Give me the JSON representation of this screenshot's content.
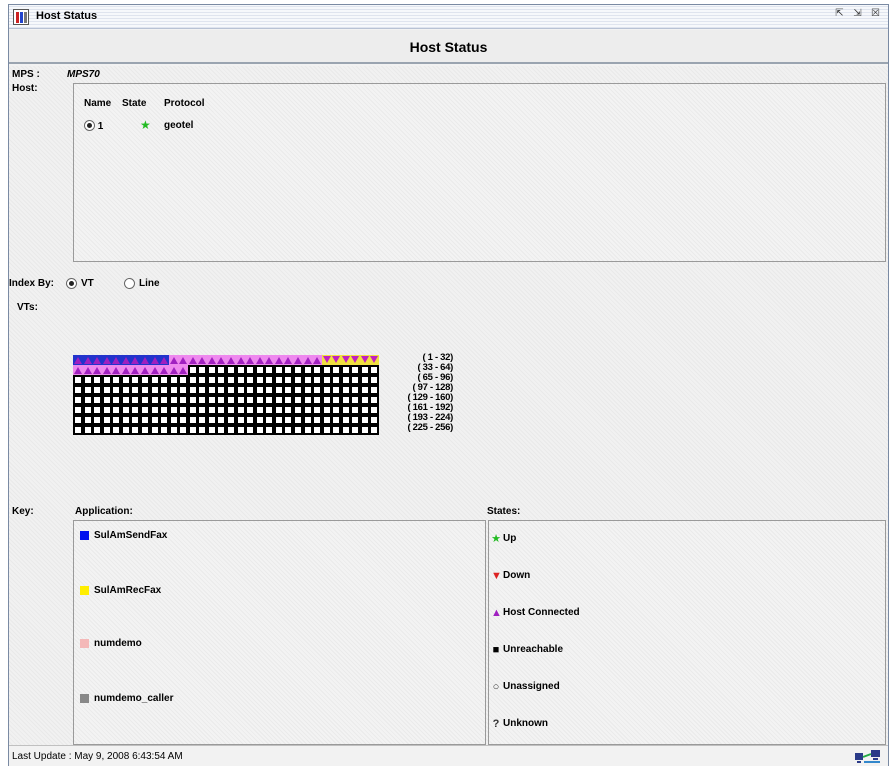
{
  "window": {
    "title": "Host Status",
    "controls": {
      "restore": "⇱",
      "maximize": "⇲",
      "close": "☒"
    }
  },
  "header": {
    "title": "Host Status"
  },
  "mps": {
    "label": "MPS :",
    "value": "MPS70"
  },
  "host": {
    "label": "Host:",
    "columns": [
      "Name",
      "State",
      "Protocol"
    ],
    "rows": [
      {
        "name": "1",
        "state_icon": "star-up-icon",
        "protocol": "geotel",
        "selected": true
      }
    ]
  },
  "index_by": {
    "label": "Index By:",
    "options": [
      "VT",
      "Line"
    ],
    "selected": "VT"
  },
  "vts": {
    "label": "VTs:",
    "ranges": [
      "( 1 - 32)",
      "( 33 - 64)",
      "( 65 - 96)",
      "( 97 - 128)",
      "( 129 - 160)",
      "( 161 - 192)",
      "( 193 - 224)",
      "( 225 - 256)"
    ],
    "cell_states": {
      "row1": "10 blue host-connected, 16 host-connected, 6 yellow down",
      "row2": "12 host-connected, rest unreachable",
      "rows3_8": "unreachable"
    },
    "colors": {
      "blue": "#2233cc",
      "yellow": "#f0e040",
      "connected": "#ee88ee",
      "unreachable": "#000000"
    }
  },
  "key": {
    "label": "Key:",
    "application_label": "Application:",
    "applications": [
      {
        "name": "SulAmSendFax",
        "color": "#0010ee"
      },
      {
        "name": "SulAmRecFax",
        "color": "#ffee00"
      },
      {
        "name": "numdemo",
        "color": "#f4b8b8"
      },
      {
        "name": "numdemo_caller",
        "color": "#888888"
      }
    ],
    "states_label": "States:",
    "states": [
      {
        "name": "Up",
        "icon": "star-icon",
        "glyph": "★",
        "color": "#22bb22"
      },
      {
        "name": "Down",
        "icon": "triangle-down-icon",
        "glyph": "▼",
        "color": "#dd2222"
      },
      {
        "name": "Host Connected",
        "icon": "triangle-up-icon",
        "glyph": "▲",
        "color": "#a020c0"
      },
      {
        "name": "Unreachable",
        "icon": "square-icon",
        "glyph": "■",
        "color": "#000000"
      },
      {
        "name": "Unassigned",
        "icon": "circle-icon",
        "glyph": "○",
        "color": "#333333"
      },
      {
        "name": "Unknown",
        "icon": "question-icon",
        "glyph": "?",
        "color": "#333333"
      }
    ]
  },
  "status": {
    "last_update": "Last Update : May 9, 2008 6:43:54 AM"
  }
}
